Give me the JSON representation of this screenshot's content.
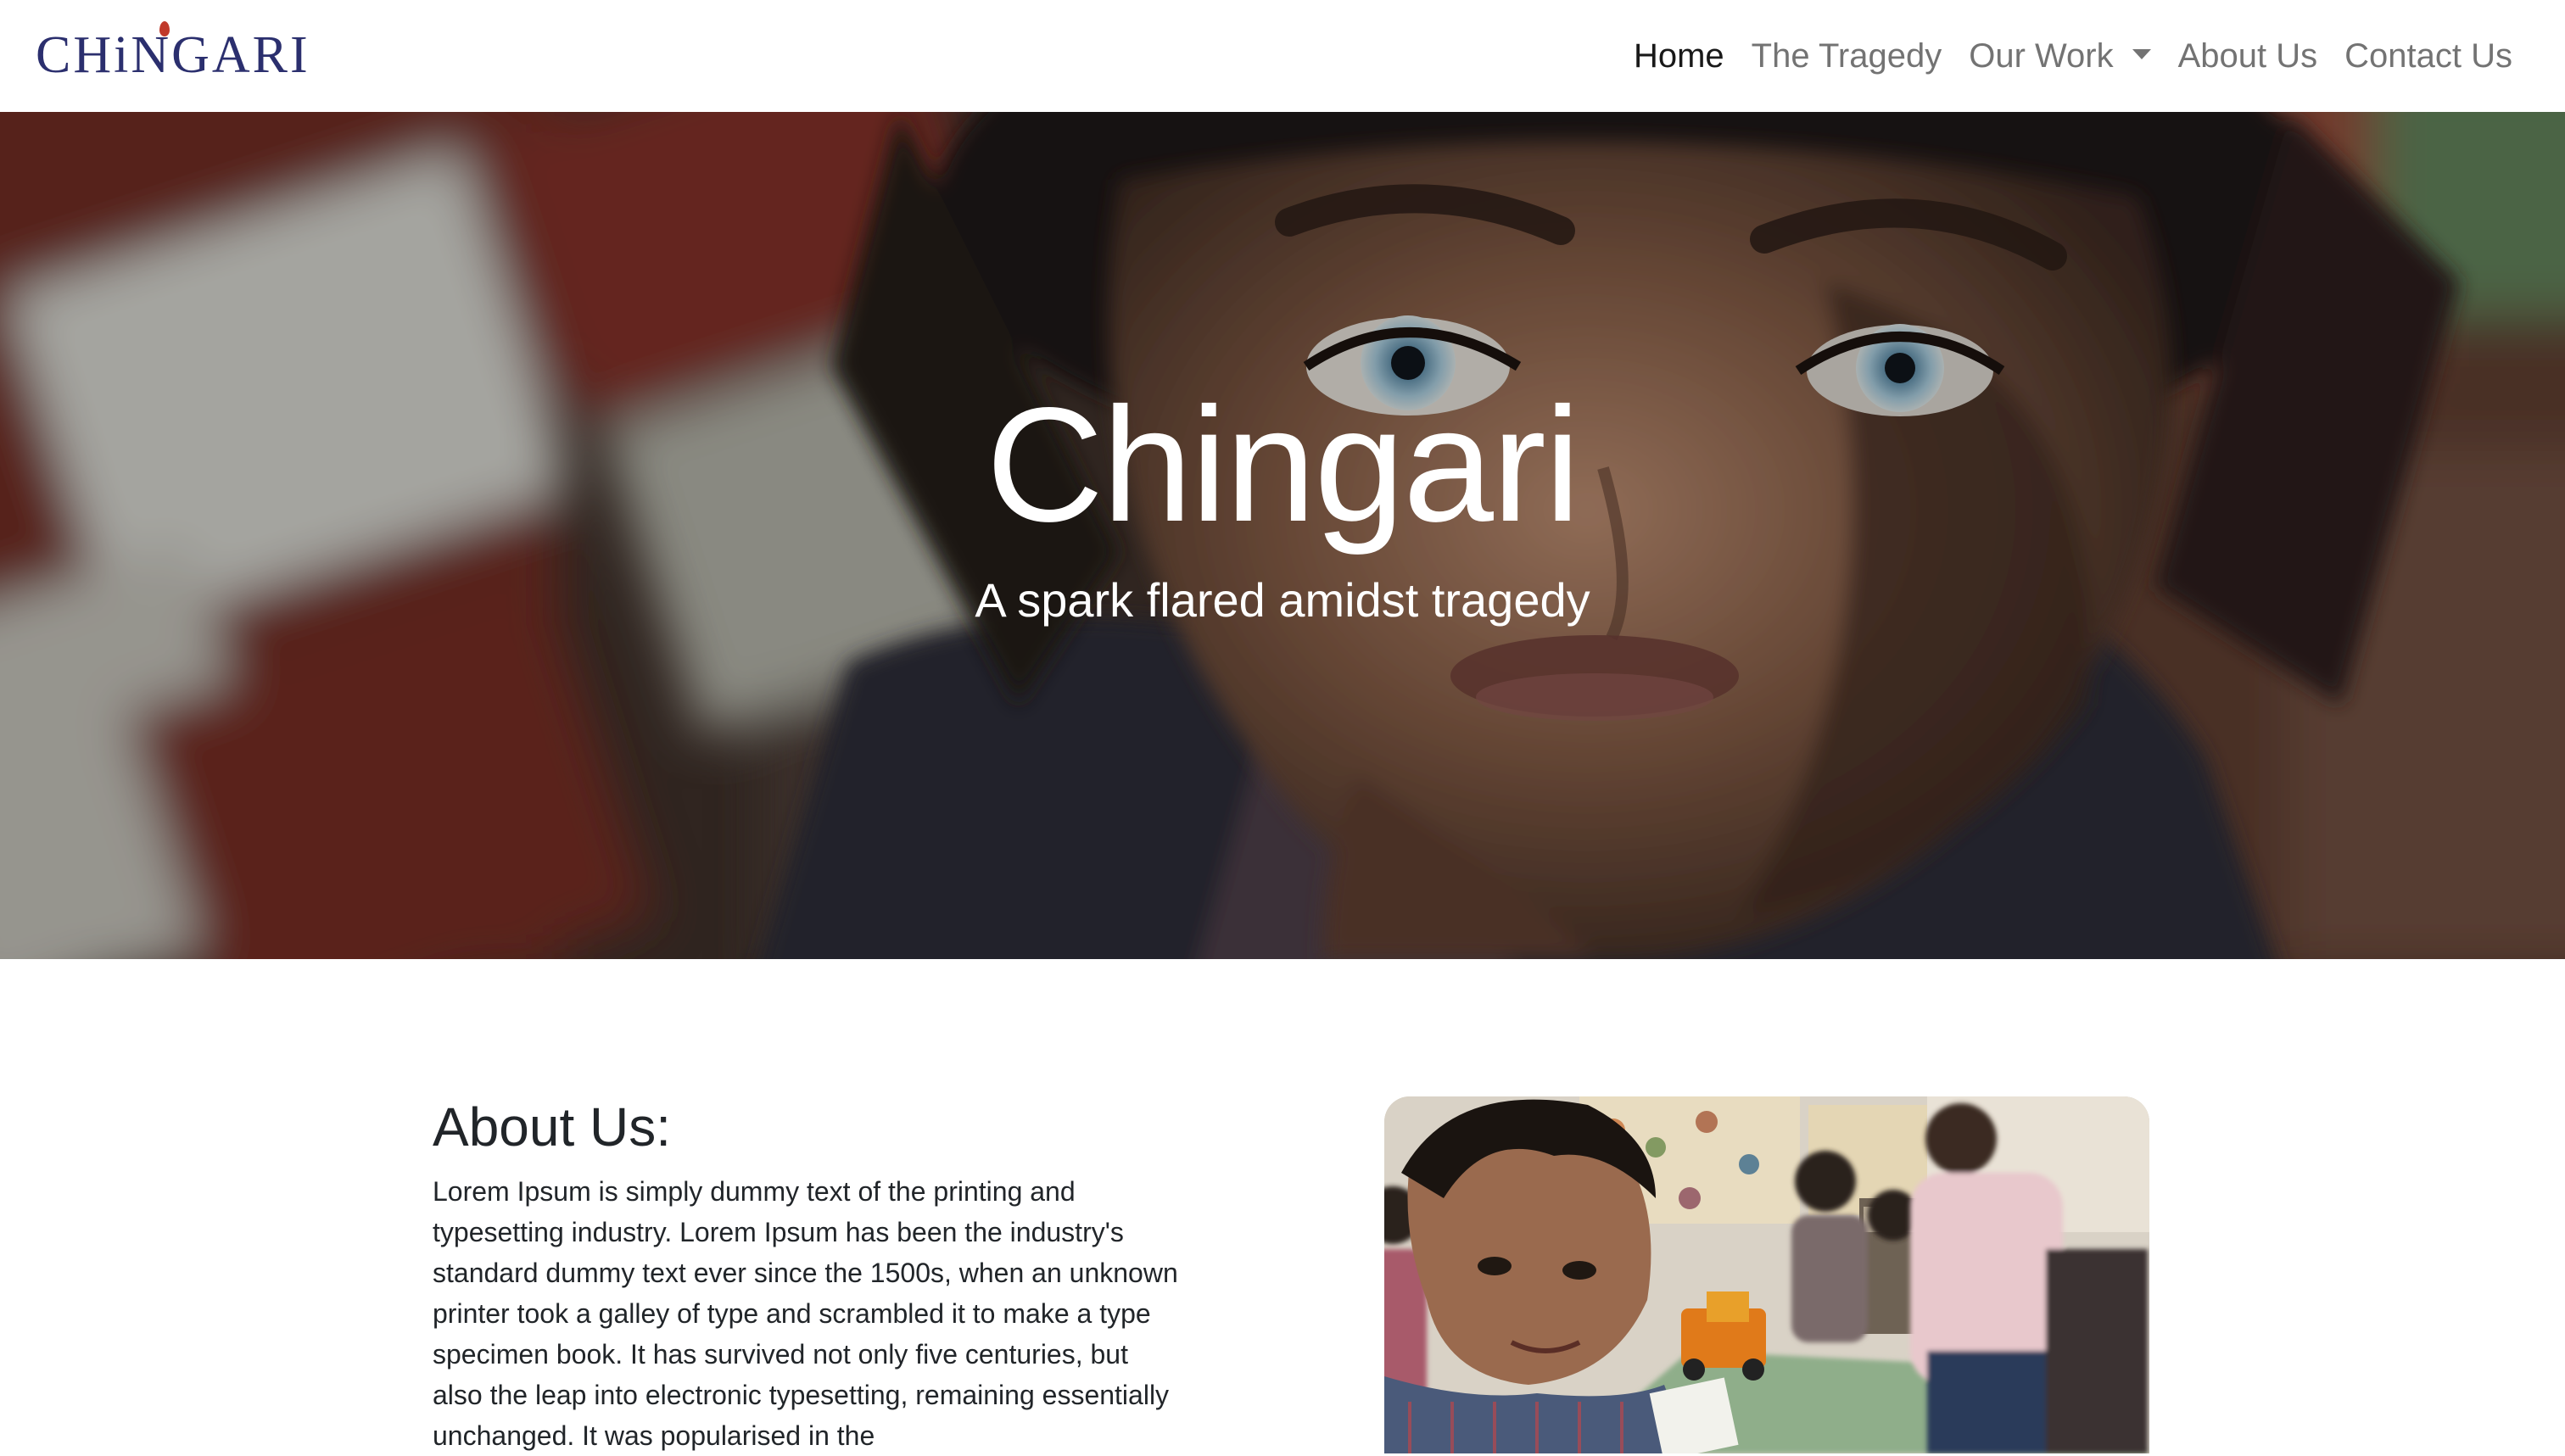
{
  "brand": {
    "logo_text": "CHiNGARI",
    "logo_color": "#2b2f6e",
    "flame_color": "#c0392b"
  },
  "nav": {
    "items": [
      {
        "label": "Home",
        "active": true
      },
      {
        "label": "The Tragedy",
        "active": false
      },
      {
        "label": "Our Work",
        "active": false,
        "dropdown": true
      },
      {
        "label": "About Us",
        "active": false
      },
      {
        "label": "Contact Us",
        "active": false
      }
    ]
  },
  "hero": {
    "title": "Chingari",
    "subtitle": "A spark flared amidst tragedy"
  },
  "about": {
    "heading": "About Us:",
    "body": "Lorem Ipsum is simply dummy text of the printing and typesetting industry. Lorem Ipsum has been the industry's standard dummy text ever since the 1500s, when an unknown printer took a galley of type and scrambled it to make a type specimen book. It has survived not only five centuries, but also the leap into electronic typesetting, remaining essentially unchanged. It was popularised in the"
  }
}
